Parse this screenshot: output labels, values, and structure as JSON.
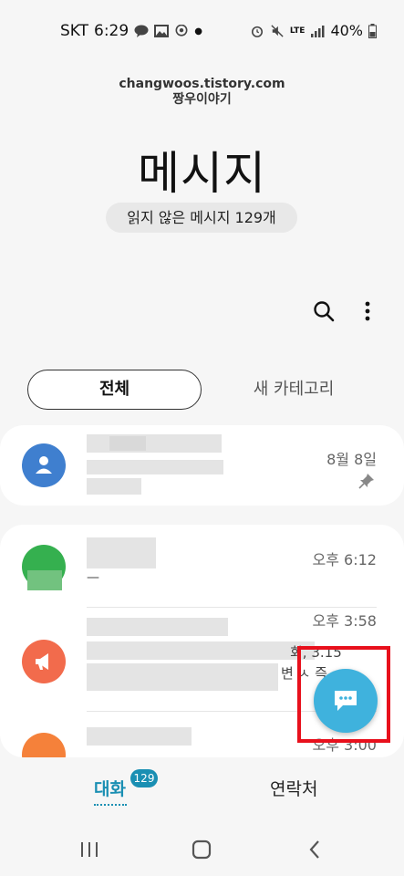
{
  "status": {
    "carrier": "SKT",
    "time": "6:29",
    "lte": "LTE",
    "battery": "40%"
  },
  "watermark": {
    "line1": "changwoos.tistory.com",
    "line2": "짱우이야기"
  },
  "header": {
    "title": "메시지",
    "unread": "읽지 않은 메시지 129개"
  },
  "tabs": {
    "all": "전체",
    "new_category": "새 카테고리"
  },
  "conversations": [
    {
      "time": "8월 8일",
      "pinned": true,
      "avatar_color": "#3f7fcf"
    },
    {
      "time": "오후 6:12",
      "preview": "—",
      "avatar_color": "#35b04f"
    },
    {
      "time": "오후 3:58",
      "snippet1": "회, 3.15",
      "snippet2": "변 ㅅ 즉",
      "avatar_color": "#f26b4c"
    },
    {
      "time": "오후 3:00",
      "avatar_color": "#f5813a"
    }
  ],
  "bottom_nav": {
    "conversations": "대화",
    "badge": "129",
    "contacts": "연락처"
  },
  "colors": {
    "accent": "#1a8fb3",
    "fab": "#3fb2dd",
    "highlight": "#e8101c"
  }
}
